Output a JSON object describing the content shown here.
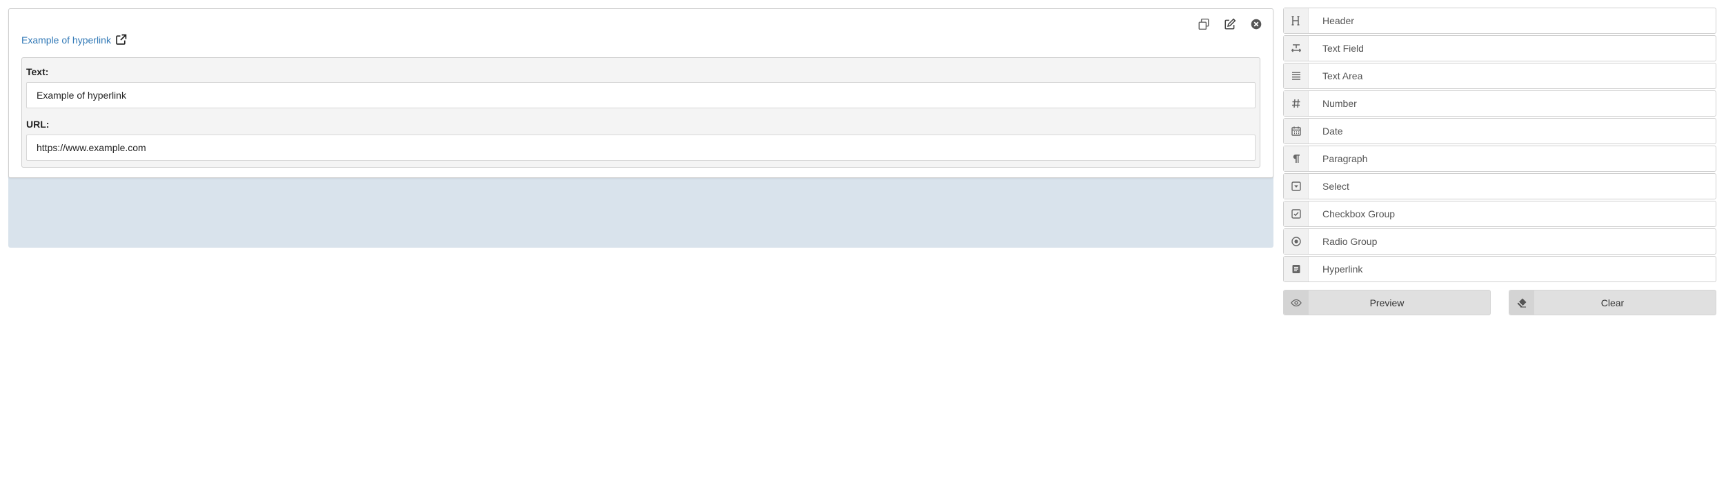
{
  "field": {
    "link_text": "Example of hyperlink",
    "text_label": "Text:",
    "text_value": "Example of hyperlink",
    "url_label": "URL:",
    "url_value": "https://www.example.com",
    "actions": {
      "copy": "copy-icon",
      "edit": "edit-icon",
      "remove": "remove-icon"
    }
  },
  "palette": {
    "items": [
      {
        "label": "Header",
        "icon": "heading-icon"
      },
      {
        "label": "Text Field",
        "icon": "text-field-icon"
      },
      {
        "label": "Text Area",
        "icon": "lines-icon"
      },
      {
        "label": "Number",
        "icon": "hash-icon"
      },
      {
        "label": "Date",
        "icon": "calendar-icon"
      },
      {
        "label": "Paragraph",
        "icon": "pilcrow-icon"
      },
      {
        "label": "Select",
        "icon": "caret-square-icon"
      },
      {
        "label": "Checkbox Group",
        "icon": "check-square-icon"
      },
      {
        "label": "Radio Group",
        "icon": "radio-icon"
      },
      {
        "label": "Hyperlink",
        "icon": "link-doc-icon"
      }
    ]
  },
  "buttons": {
    "preview": "Preview",
    "clear": "Clear"
  },
  "colors": {
    "link": "#337ab7",
    "stage": "#d9e3ec",
    "panel": "#f4f4f4",
    "button": "#e0e0e0"
  }
}
